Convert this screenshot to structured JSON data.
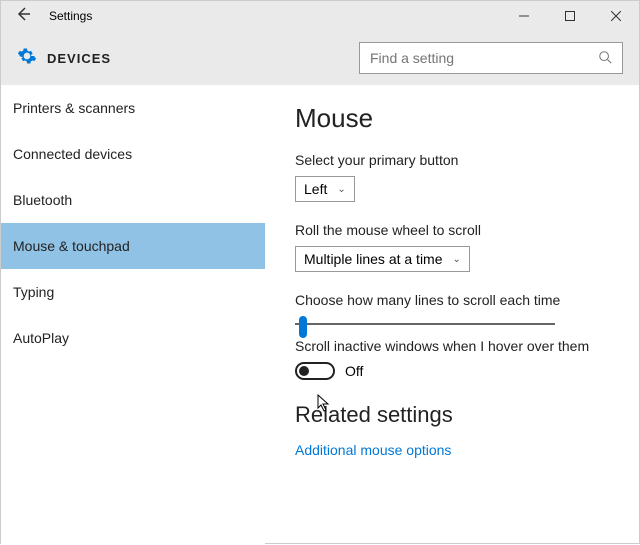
{
  "titlebar": {
    "title": "Settings"
  },
  "header": {
    "section": "DEVICES"
  },
  "search": {
    "placeholder": "Find a setting"
  },
  "sidebar": {
    "items": [
      {
        "label": "Printers & scanners"
      },
      {
        "label": "Connected devices"
      },
      {
        "label": "Bluetooth"
      },
      {
        "label": "Mouse & touchpad"
      },
      {
        "label": "Typing"
      },
      {
        "label": "AutoPlay"
      }
    ]
  },
  "main": {
    "title": "Mouse",
    "primary_label": "Select your primary button",
    "primary_value": "Left",
    "wheel_label": "Roll the mouse wheel to scroll",
    "wheel_value": "Multiple lines at a time",
    "lines_label": "Choose how many lines to scroll each time",
    "inactive_label": "Scroll inactive windows when I hover over them",
    "toggle_state": "Off",
    "related_heading": "Related settings",
    "related_link": "Additional mouse options"
  }
}
